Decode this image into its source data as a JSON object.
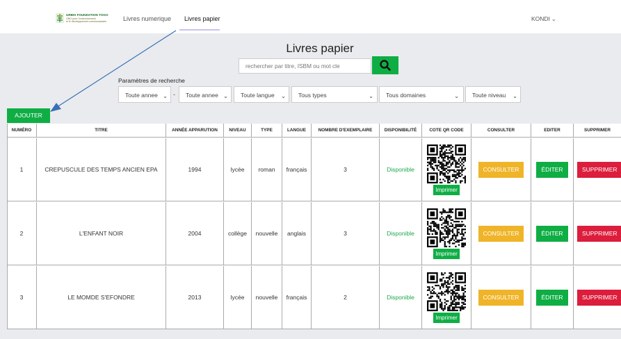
{
  "brand": {
    "line1": "URBIS FOUNDATION TOGO",
    "line2": "ONG pour l'environnement",
    "line3": "et le développement communautaire"
  },
  "nav": {
    "items": [
      {
        "label": "Livres numerique",
        "active": false
      },
      {
        "label": "Livres papier",
        "active": true
      }
    ],
    "user": "KONDI"
  },
  "page": {
    "title": "Livres papier"
  },
  "search": {
    "placeholder": "rechercher par titre, ISBM ou mot cle"
  },
  "filters": {
    "label": "Paramètres de recherche",
    "items": [
      {
        "label": "Toute annee"
      },
      {
        "label": "Toute annee"
      },
      {
        "label": "Toute langue"
      },
      {
        "label": "Tous types"
      },
      {
        "label": "Tous domaines"
      },
      {
        "label": "Toute niveau"
      }
    ],
    "separator": "-"
  },
  "actions": {
    "add_label": "AJOUTER"
  },
  "table": {
    "headers": [
      "NUMÉRO",
      "TITRE",
      "ANNÉE APPARUTION",
      "NIVEAU",
      "TYPE",
      "LANGUE",
      "NOMBRE D'EXEMPLAIRE",
      "DISPONIBILITÉ",
      "COTE QR CODE",
      "CONSULTER",
      "EDITER",
      "SUPPRIMER"
    ],
    "rows": [
      {
        "num": "1",
        "titre": "CREPUSCULE DES TEMPS ANCIEN EPA",
        "annee": "1994",
        "niveau": "lycée",
        "type": "roman",
        "langue": "français",
        "nombre": "3",
        "dispo": "Disponible"
      },
      {
        "num": "2",
        "titre": "L'ENFANT NOIR",
        "annee": "2004",
        "niveau": "collège",
        "type": "nouvelle",
        "langue": "anglais",
        "nombre": "3",
        "dispo": "Disponible"
      },
      {
        "num": "3",
        "titre": "LE MOMDE S'EFONDRE",
        "annee": "2013",
        "niveau": "lycée",
        "type": "nouvelle",
        "langue": "français",
        "nombre": "2",
        "dispo": "Disponible"
      }
    ],
    "print_label": "Imprimer",
    "consult_label": "CONSULTER",
    "edit_label": "ÉDITER",
    "delete_label": "SUPPRIMER"
  },
  "colors": {
    "primary_green": "#0fae45",
    "consult_yellow": "#f0b429",
    "delete_red": "#dc1d3c",
    "available_green": "#1aa84a",
    "annotation_arrow": "#3a6fb5"
  }
}
